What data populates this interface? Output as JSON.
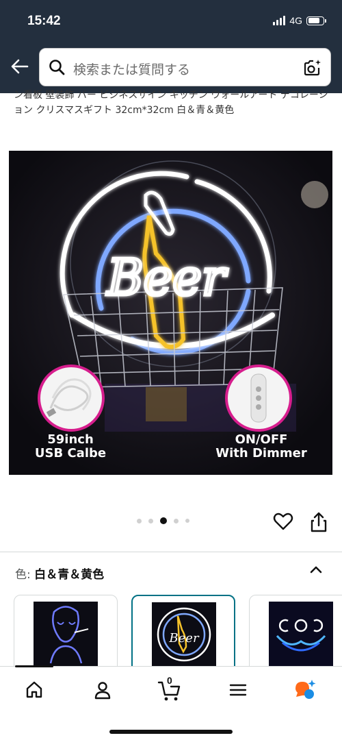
{
  "status_bar": {
    "time": "15:42",
    "network": "4G"
  },
  "search": {
    "placeholder": "検索または質問する"
  },
  "product": {
    "title": "ン看板 壁装飾 バー ビジネスサイン キッチン ウォールアート デコレーション クリスマスギフト 32cm*32cm 白＆青＆黄色",
    "image": {
      "sign_text": "Beer",
      "badge_left_caption_line1": "59inch",
      "badge_left_caption_line2": "USB Calbe",
      "badge_right_caption_line1": "ON/OFF",
      "badge_right_caption_line2": "With Dimmer"
    },
    "carousel": {
      "total": 5,
      "active_index": 2
    }
  },
  "variant": {
    "label": "色:",
    "value": "白＆青＆黄色"
  },
  "thumbnails": [
    {
      "name": "alien-neon"
    },
    {
      "name": "beer-neon",
      "thumb_text": "Beer",
      "selected": true
    },
    {
      "name": "moon-hands-neon"
    }
  ],
  "bottom_nav": {
    "cart_count": "0"
  },
  "colors": {
    "header_bg": "#232f3e",
    "accent_teal": "#007185",
    "badge_pink": "#d61e8d",
    "neon_white": "#ffffff",
    "neon_blue": "#7fa8ff",
    "neon_yellow": "#f5c22b",
    "assistant_orange": "#ff6a1a",
    "assistant_blue": "#1b8de4"
  }
}
